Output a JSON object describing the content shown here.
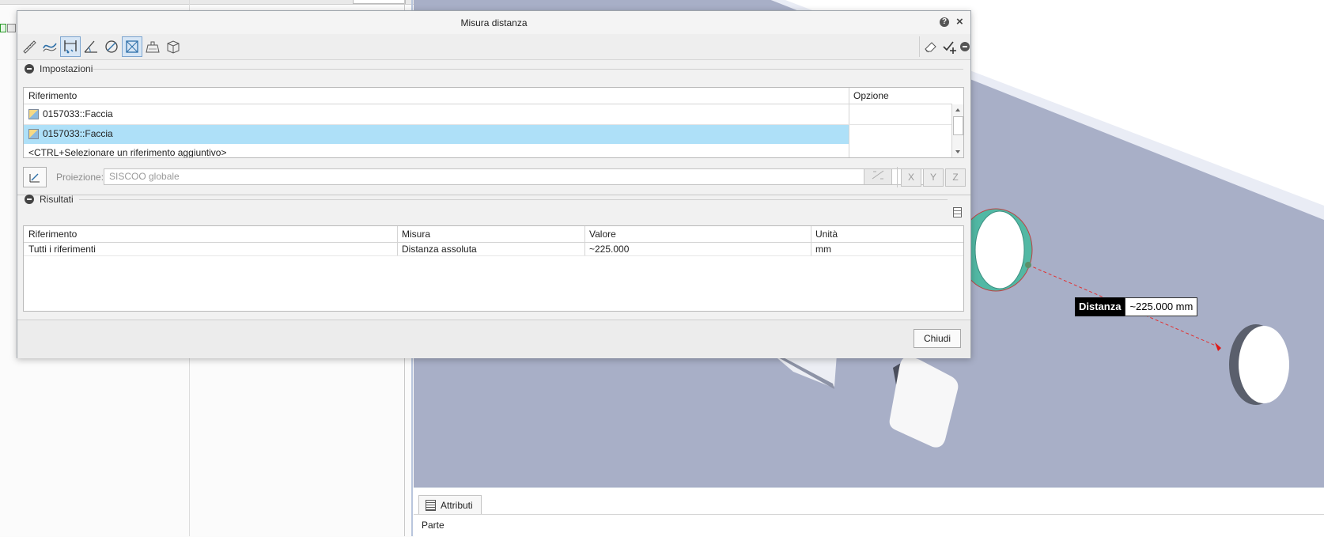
{
  "dialog": {
    "title": "Misura distanza",
    "help_icon": "?",
    "close_icon": "×"
  },
  "toolbar": {
    "tools": [
      "length-tool-icon",
      "curve-tool-icon",
      "distance-tool-icon",
      "angle-tool-icon",
      "diameter-tool-icon",
      "transform-tool-icon",
      "area-tool-icon",
      "volume-tool-icon"
    ],
    "right_tools": [
      "eraser-icon",
      "save-measure-icon",
      "collapse-icon"
    ]
  },
  "settings": {
    "title": "Impostazioni",
    "columns": [
      "Riferimento",
      "Opzione"
    ],
    "rows": [
      {
        "ref": "0157033::Faccia",
        "option": ""
      },
      {
        "ref": "0157033::Faccia",
        "option": ""
      }
    ],
    "add_hint": "<CTRL+Selezionare un riferimento aggiuntivo>",
    "projection_label": "Proiezione:",
    "projection_placeholder": "SISCOO globale",
    "axes": [
      "X",
      "Y",
      "Z"
    ]
  },
  "results": {
    "title": "Risultati",
    "columns": [
      "Riferimento",
      "Misura",
      "Valore",
      "Unità"
    ],
    "rows": [
      {
        "ref": "Tutti i riferimenti",
        "measure": "Distanza assoluta",
        "value": "~225.000",
        "unit": "mm"
      }
    ]
  },
  "footer": {
    "close_label": "Chiudi"
  },
  "viewport": {
    "label_key": "Distanza",
    "label_value": "~225.000 mm"
  },
  "attributes": {
    "tab_label": "Attributi",
    "row_label": "Parte"
  }
}
